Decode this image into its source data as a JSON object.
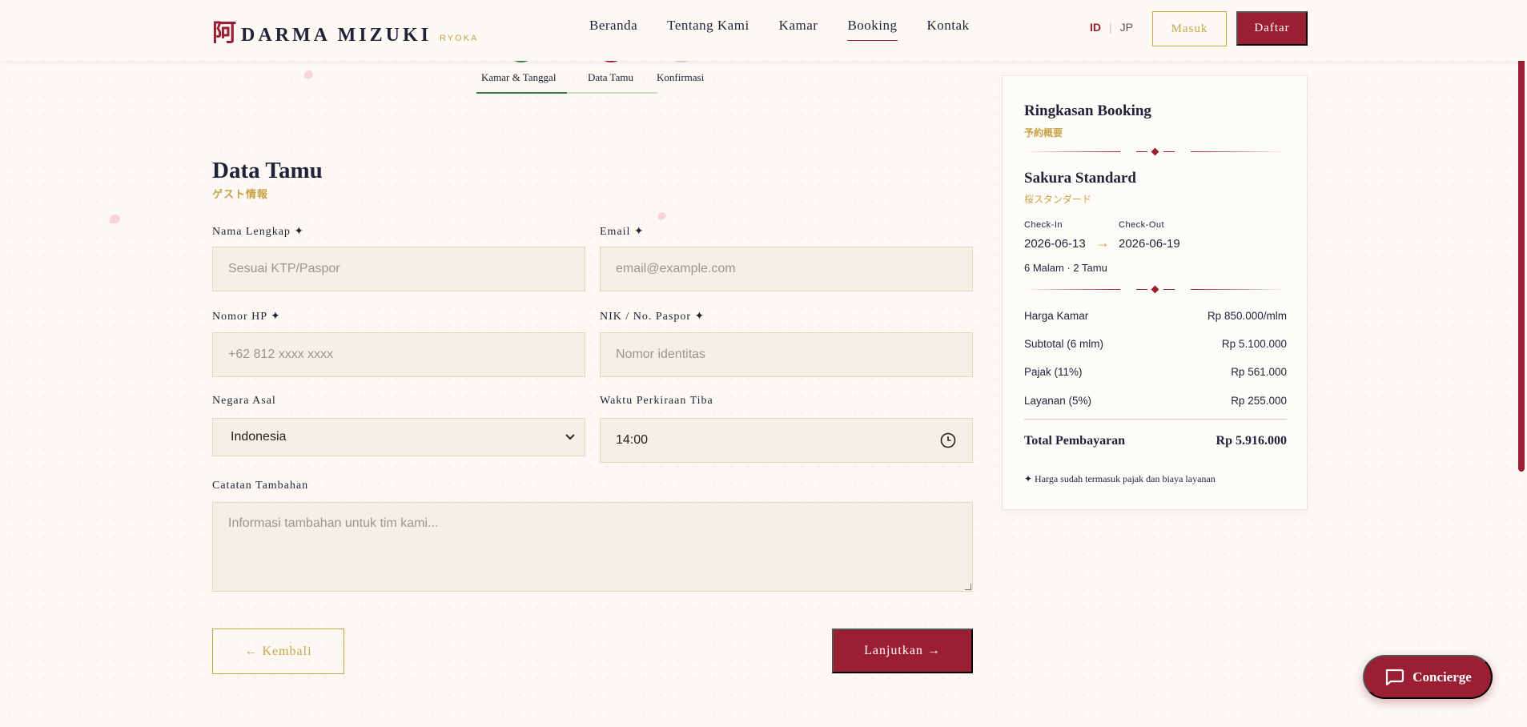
{
  "header": {
    "logo_kanji": "阿",
    "logo_name": "DARMA MIZUKI",
    "logo_sub": "RYOKA",
    "nav": [
      "Beranda",
      "Tentang Kami",
      "Kamar",
      "Booking",
      "Kontak"
    ],
    "active_nav": "Booking",
    "lang_id": "ID",
    "lang_sep": "|",
    "lang_jp": "JP",
    "login_label": "Masuk",
    "register_label": "Daftar"
  },
  "steps": {
    "items": [
      "Kamar & Tanggal",
      "Data Tamu",
      "Konfirmasi"
    ],
    "colors": {
      "done": "#3f7a4a",
      "current": "#9b1e33",
      "todo": "#d9d0c0"
    }
  },
  "form": {
    "title": "Data Tamu",
    "subtitle": "ゲスト情報",
    "name_label": "Nama Lengkap ✦",
    "name_placeholder": "Sesuai KTP/Paspor",
    "email_label": "Email ✦",
    "email_placeholder": "email@example.com",
    "phone_label": "Nomor HP ✦",
    "phone_placeholder": "+62 812 xxxx xxxx",
    "nik_label": "NIK / No. Paspor ✦",
    "nik_placeholder": "Nomor identitas",
    "country_label": "Negara Asal",
    "country_value": "Indonesia",
    "arrival_label": "Waktu Perkiraan Tiba",
    "arrival_value": "14:00",
    "notes_label": "Catatan Tambahan",
    "notes_placeholder": "Informasi tambahan untuk tim kami...",
    "back_label": "← Kembali",
    "next_label": "Lanjutkan →"
  },
  "summary": {
    "title": "Ringkasan Booking",
    "subtitle": "予約概要",
    "room_name": "Sakura Standard",
    "room_jp": "桜スタンダード",
    "checkin_label": "Check-In",
    "checkin_value": "2026-06-13",
    "arrow": "→",
    "checkout_label": "Check-Out",
    "checkout_value": "2026-06-19",
    "nights_guests": "6 Malam · 2 Tamu",
    "rows": [
      {
        "label": "Harga Kamar",
        "value": "Rp 850.000/mlm"
      },
      {
        "label": "Subtotal (6 mlm)",
        "value": "Rp 5.100.000"
      },
      {
        "label": "Pajak (11%)",
        "value": "Rp 561.000"
      },
      {
        "label": "Layanan (5%)",
        "value": "Rp 255.000"
      }
    ],
    "total_label": "Total Pembayaran",
    "total_value": "Rp 5.916.000",
    "note": "✦ Harga sudah termasuk pajak dan biaya layanan"
  },
  "concierge_label": "Concierge",
  "colors": {
    "brand": "#9b1e33",
    "gold": "#c8a347",
    "ink": "#1f2238",
    "background": "#fcf9f4"
  }
}
